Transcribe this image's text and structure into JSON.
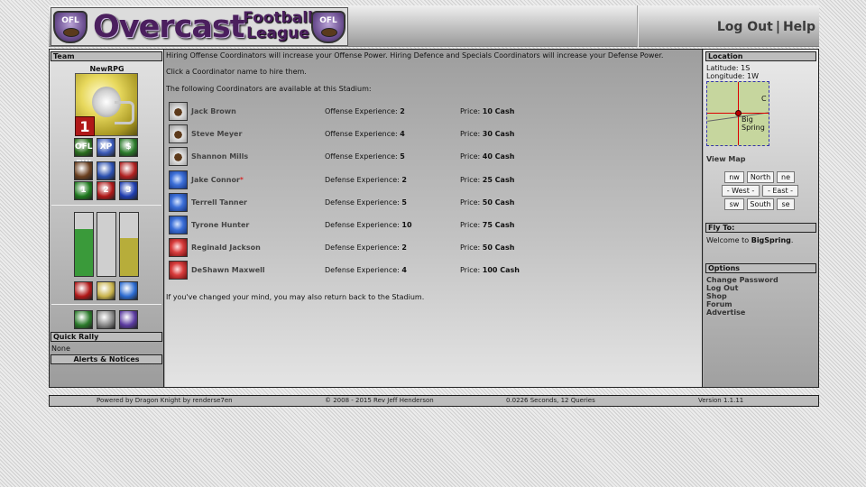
{
  "header": {
    "logo_badge": "OFL",
    "logo_main": "Overcast",
    "logo_sub_line1": "Football",
    "logo_sub_line2": "League",
    "logout_label": "Log Out",
    "separator": "|",
    "help_label": "Help"
  },
  "left": {
    "team_title": "Team",
    "team_name": "NewRPG",
    "rank": "1",
    "icons_row1": [
      {
        "name": "ofl-pw-icon",
        "label": "OFL PW",
        "color": "#2a6e1d"
      },
      {
        "name": "xp-icon",
        "label": "XP",
        "color": "#3a5ab8"
      },
      {
        "name": "cash-icon",
        "label": "$",
        "color": "#2a7a2a"
      }
    ],
    "icons_row2": [
      {
        "name": "football-icon",
        "label": "",
        "color": "#6b4020"
      },
      {
        "name": "blue-helmet-icon",
        "label": "",
        "color": "#2a4fb0"
      },
      {
        "name": "red-helmet-icon",
        "label": "",
        "color": "#b02020"
      }
    ],
    "icons_row3": [
      {
        "name": "first-down-icon",
        "label": "1",
        "color": "#1e7a1e"
      },
      {
        "name": "second-down-icon",
        "label": "2",
        "color": "#b01818"
      },
      {
        "name": "third-down-icon",
        "label": "3",
        "color": "#1e3db0"
      }
    ],
    "bars": [
      {
        "name": "green-stat-bar",
        "level": 0.75,
        "color": "#3a9a3a"
      },
      {
        "name": "gray-stat-bar",
        "level": 0.0,
        "color": "#aaaaaa"
      },
      {
        "name": "yellow-stat-bar",
        "level": 0.6,
        "color": "#b7ad3a"
      }
    ],
    "icons_row4": [
      {
        "name": "red-flag-icon",
        "color": "#b01818"
      },
      {
        "name": "bell-icon",
        "color": "#c8b24a"
      },
      {
        "name": "plane-icon",
        "color": "#2a6ad0"
      }
    ],
    "icons_row5": [
      {
        "name": "trade-icon",
        "color": "#2a7a2a"
      },
      {
        "name": "gear-icon",
        "color": "#888888"
      },
      {
        "name": "players-icon",
        "color": "#5a3aa0"
      }
    ],
    "quick_rally_title": "Quick Rally",
    "quick_rally_value": "None",
    "alerts_title": "Alerts & Notices"
  },
  "center": {
    "intro1": "Hiring Offense Coordinators will increase your Offense Power. Hiring Defence and Specials Coordinators will increase your Defense Power.",
    "intro2": "Click a Coordinator name to hire them.",
    "intro3": "The following Coordinators are available at this Stadium:",
    "coordinators": [
      {
        "name": "Jack Brown",
        "star": "",
        "type_label": "Offense Experience:",
        "exp": "2",
        "price_label": "Price:",
        "price": "10 Cash",
        "icon": "off-ico"
      },
      {
        "name": "Steve Meyer",
        "star": "",
        "type_label": "Offense Experience:",
        "exp": "4",
        "price_label": "Price:",
        "price": "30 Cash",
        "icon": "off-ico"
      },
      {
        "name": "Shannon Mills",
        "star": "",
        "type_label": "Offense Experience:",
        "exp": "5",
        "price_label": "Price:",
        "price": "40 Cash",
        "icon": "off-ico"
      },
      {
        "name": "Jake Connor",
        "star": "*",
        "type_label": "Defense Experience:",
        "exp": "2",
        "price_label": "Price:",
        "price": "25 Cash",
        "icon": "def-blue"
      },
      {
        "name": "Terrell Tanner",
        "star": "",
        "type_label": "Defense Experience:",
        "exp": "5",
        "price_label": "Price:",
        "price": "50 Cash",
        "icon": "def-blue"
      },
      {
        "name": "Tyrone Hunter",
        "star": "",
        "type_label": "Defense Experience:",
        "exp": "10",
        "price_label": "Price:",
        "price": "75 Cash",
        "icon": "def-blue"
      },
      {
        "name": "Reginald Jackson",
        "star": "",
        "type_label": "Defense Experience:",
        "exp": "2",
        "price_label": "Price:",
        "price": "50 Cash",
        "icon": "def-red"
      },
      {
        "name": "DeShawn Maxwell",
        "star": "",
        "type_label": "Defense Experience:",
        "exp": "4",
        "price_label": "Price:",
        "price": "100 Cash",
        "icon": "def-red"
      }
    ],
    "outro": "If you've changed your mind, you may also return back to the Stadium."
  },
  "right": {
    "location_title": "Location",
    "latitude": "Latitude: 1S",
    "longitude": "Longitude: 1W",
    "map_label": "Big Spring",
    "map_label2": "C",
    "view_map": "View Map",
    "nav": {
      "nw": "nw",
      "north": "North",
      "ne": "ne",
      "west": "- West -",
      "east": "- East -",
      "sw": "sw",
      "south": "South",
      "se": "se"
    },
    "fly_title": "Fly To:",
    "welcome_prefix": "Welcome to ",
    "welcome_place": "BigSpring",
    "welcome_suffix": ".",
    "options_title": "Options",
    "options": [
      "Change Password",
      "Log Out",
      "Shop",
      "Forum",
      "Advertise"
    ]
  },
  "footer": {
    "powered": "Powered by Dragon Knight by renderse7en",
    "copyright": "© 2008 - 2015 Rev Jeff Henderson",
    "stats": "0.0226 Seconds, 12 Queries",
    "version": "Version 1.1.11"
  }
}
